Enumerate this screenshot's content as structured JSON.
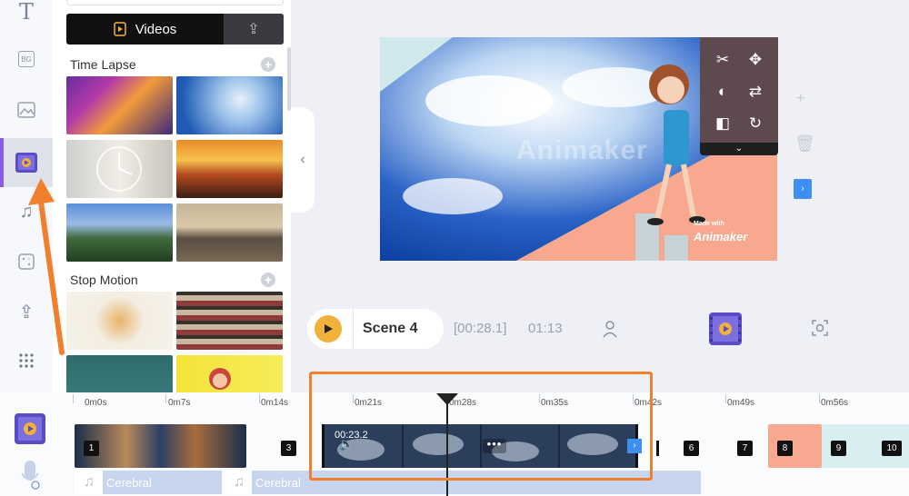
{
  "panel": {
    "tab_videos_label": "Videos",
    "section_timelapse": "Time Lapse",
    "section_stopmotion": "Stop Motion"
  },
  "canvas": {
    "watermark": "Animaker",
    "made_with": "Made with",
    "brand": "Animaker"
  },
  "scene_bar": {
    "scene_label": "Scene 4",
    "current_time": "[00:28.1]",
    "total_time": "01:13"
  },
  "timeline": {
    "ruler": [
      "0m0s",
      "0m7s",
      "0m14s",
      "0m21s",
      "0m28s",
      "0m35s",
      "0m42s",
      "0m49s",
      "0m56s"
    ],
    "clip_time": "00:23.2",
    "scene_numbers": [
      "1",
      "3",
      "6",
      "7",
      "8",
      "9",
      "10"
    ],
    "audio_labels": [
      "Cerebral",
      "Cerebral"
    ]
  },
  "colors": {
    "accent": "#8a5ce0",
    "highlight": "#f07f2e",
    "play": "#f2b13b",
    "selection": "#3e8ff2"
  }
}
